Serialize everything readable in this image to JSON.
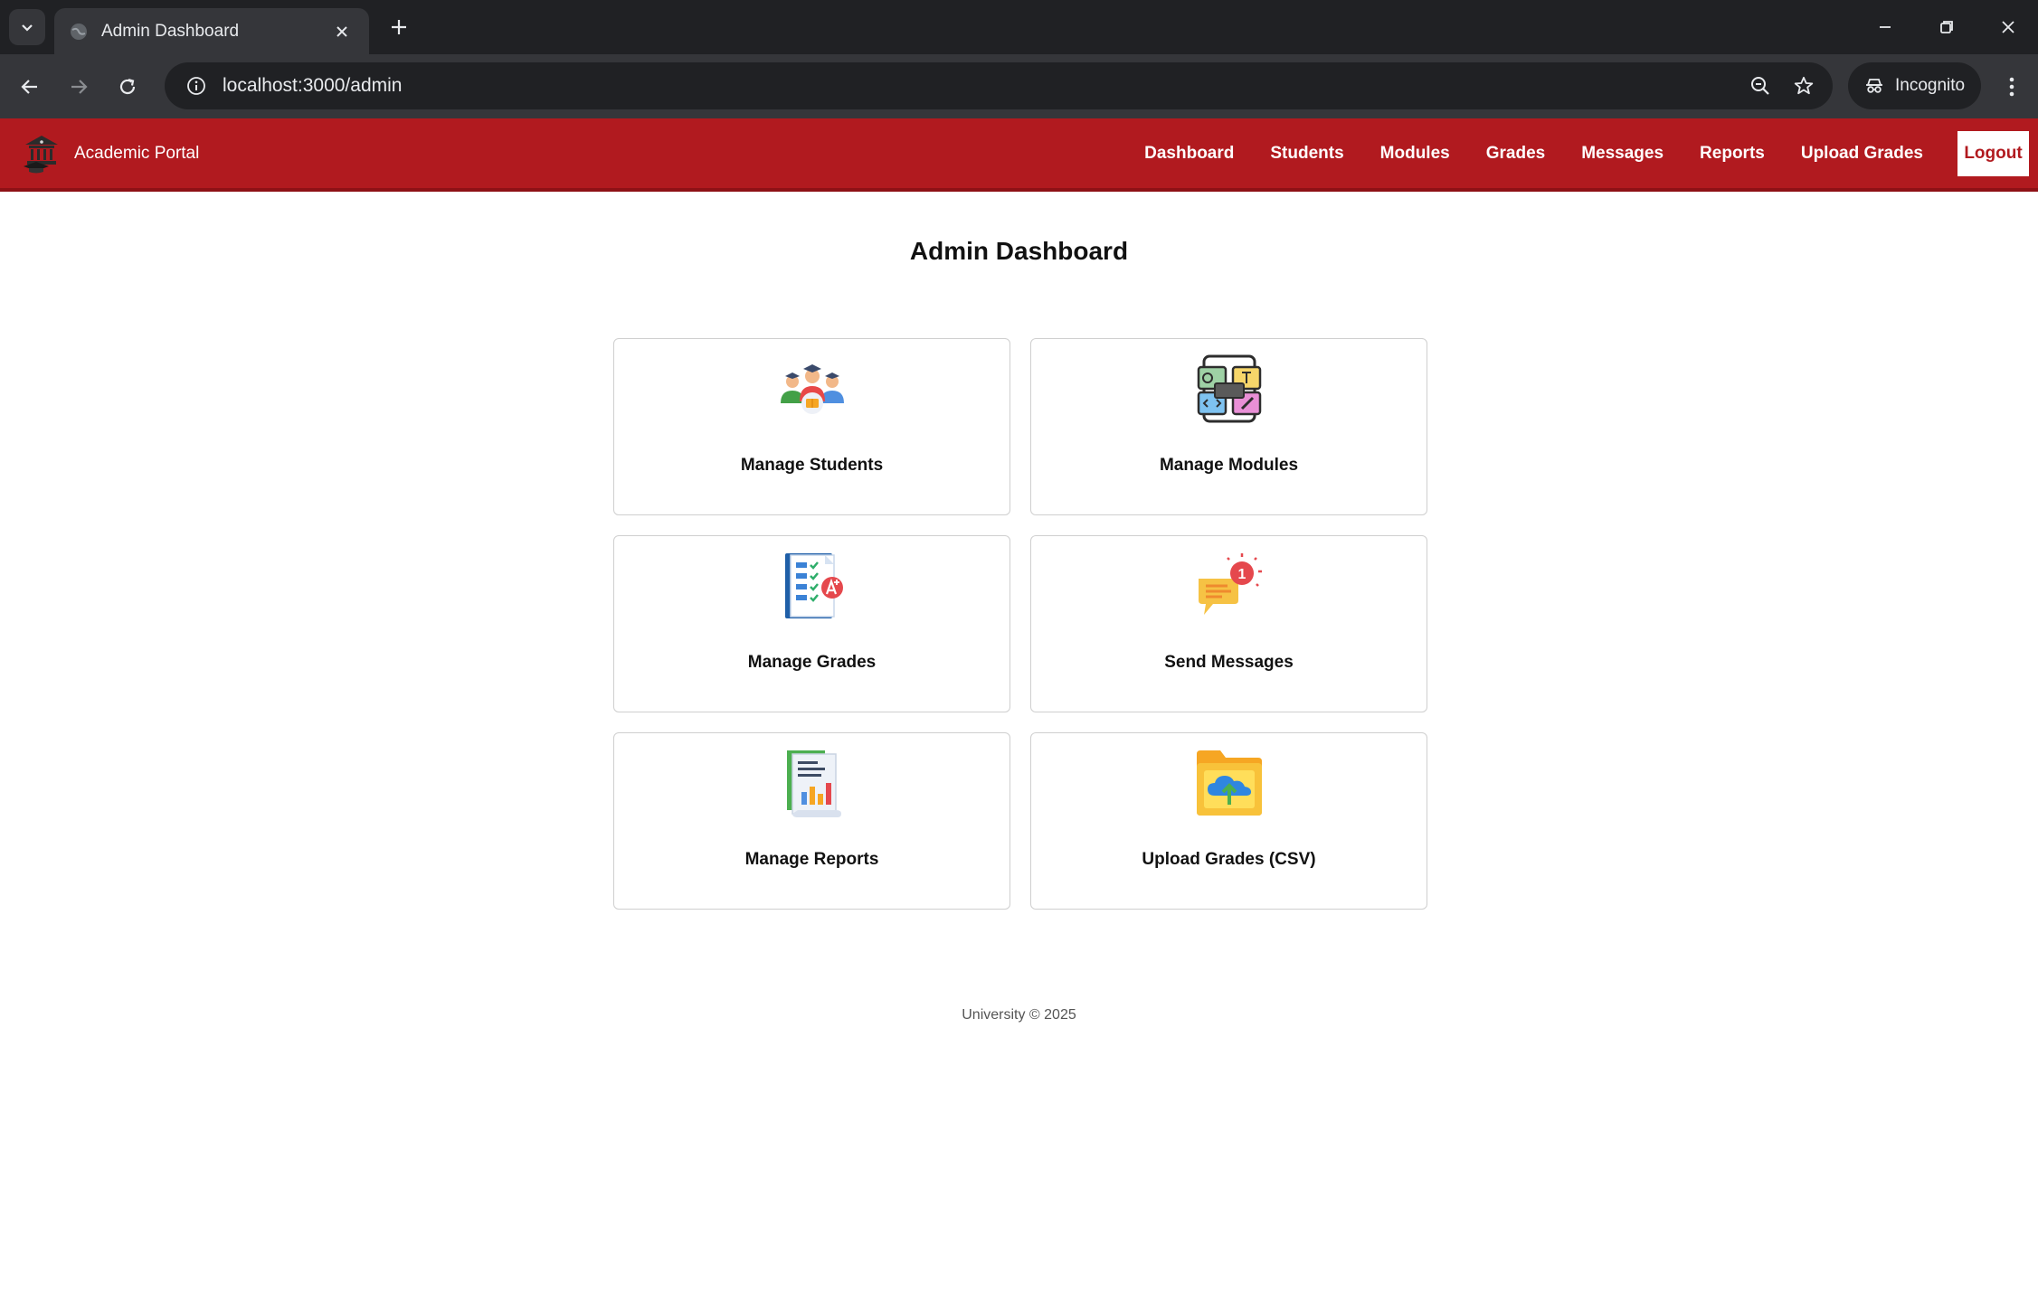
{
  "browser": {
    "tab_title": "Admin Dashboard",
    "url": "localhost:3000/admin",
    "incognito_label": "Incognito"
  },
  "nav": {
    "brand": "Academic Portal",
    "links": [
      "Dashboard",
      "Students",
      "Modules",
      "Grades",
      "Messages",
      "Reports",
      "Upload Grades"
    ],
    "logout": "Logout"
  },
  "main": {
    "title": "Admin Dashboard",
    "cards": [
      {
        "label": "Manage Students",
        "icon": "students-icon"
      },
      {
        "label": "Manage Modules",
        "icon": "modules-icon"
      },
      {
        "label": "Manage Grades",
        "icon": "grades-icon"
      },
      {
        "label": "Send Messages",
        "icon": "messages-icon"
      },
      {
        "label": "Manage Reports",
        "icon": "reports-icon"
      },
      {
        "label": "Upload Grades (CSV)",
        "icon": "upload-csv-icon"
      }
    ],
    "message_badge": "1"
  },
  "footer": {
    "text": "University © 2025"
  },
  "colors": {
    "nav_red": "#b11a1f",
    "chrome_dark": "#202124",
    "chrome_mid": "#35363a"
  }
}
